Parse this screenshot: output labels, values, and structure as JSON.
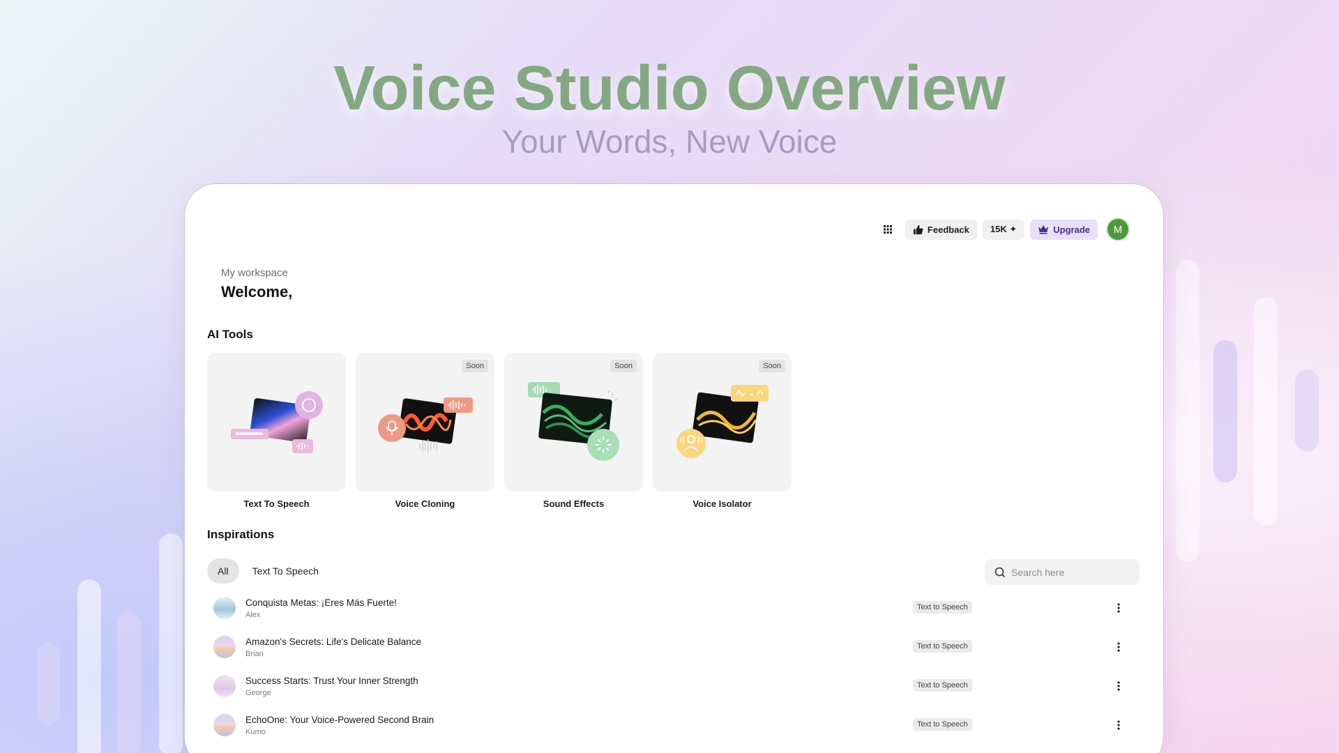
{
  "hero": {
    "title": "Voice Studio Overview",
    "subtitle": "Your Words, New Voice"
  },
  "topbar": {
    "apps_icon": "grid-icon",
    "feedback_label": "Feedback",
    "credits_label": "15K ✦",
    "upgrade_label": "Upgrade",
    "avatar_initial": "M"
  },
  "workspace": {
    "label": "My workspace",
    "welcome": "Welcome,"
  },
  "ai_tools": {
    "title": "AI Tools",
    "items": [
      {
        "label": "Text To Speech",
        "badge": ""
      },
      {
        "label": "Voice Cloning",
        "badge": "Soon"
      },
      {
        "label": "Sound Effects",
        "badge": "Soon"
      },
      {
        "label": "Voice Isolator",
        "badge": "Soon"
      }
    ]
  },
  "inspirations": {
    "title": "Inspirations",
    "tabs": [
      "All",
      "Text To Speech"
    ],
    "active_tab": "All",
    "search_placeholder": "Search here",
    "rows": [
      {
        "title": "Conquista Metas: ¡Eres Más Fuerte!",
        "author": "Alex",
        "tag": "Text to Speech"
      },
      {
        "title": "Amazon's Secrets: Life's Delicate Balance",
        "author": "Brian",
        "tag": "Text to Speech"
      },
      {
        "title": "Success Starts: Trust Your Inner Strength",
        "author": "George",
        "tag": "Text to Speech"
      },
      {
        "title": "EchoOne: Your Voice-Powered Second Brain",
        "author": "Kumo",
        "tag": "Text to Speech"
      }
    ]
  },
  "colors": {
    "hero_title": "#84a982",
    "hero_subtitle": "#a59cbf",
    "upgrade_text": "#4a2f8a",
    "avatar_bg": "#4d9a3b"
  }
}
